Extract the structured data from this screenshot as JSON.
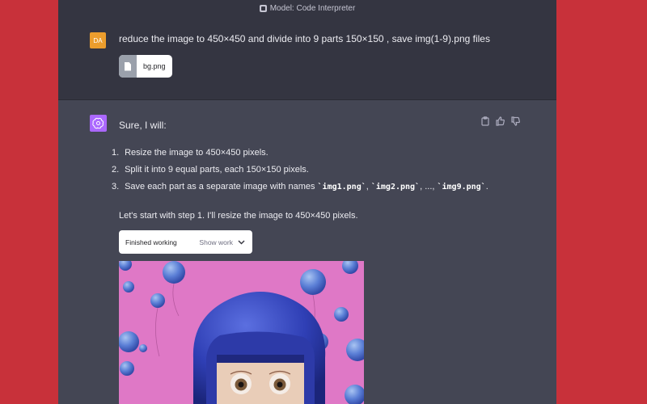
{
  "model_bar": {
    "label": "Model: Code Interpreter",
    "icon": "code-interpreter-icon"
  },
  "user": {
    "avatar_initials": "DA",
    "message": "reduce the image to 450×450 and divide into 9 parts 150×150 , save img(1-9).png files",
    "attachment": {
      "filename": "bg.png",
      "icon": "file-icon"
    }
  },
  "assistant": {
    "intro": "Sure, I will:",
    "steps": [
      {
        "num": "1.",
        "text": "Resize the image to 450×450 pixels."
      },
      {
        "num": "2.",
        "text": "Split it into 9 equal parts, each 150×150 pixels."
      },
      {
        "num": "3.",
        "pre": "Save each part as a separate image with names ",
        "code1": "`img1.png`",
        "sep1": ", ",
        "code2": "`img2.png`",
        "sep2": ", ..., ",
        "code3": "`img9.png`",
        "post": "."
      }
    ],
    "start_text": "Let's start with step 1. I'll resize the image to 450×450 pixels.",
    "working": {
      "label": "Finished working",
      "show_label": "Show work"
    },
    "actions": [
      "copy-icon",
      "thumbs-up-icon",
      "thumbs-down-icon"
    ]
  },
  "colors": {
    "background": "#c8313a",
    "user_bg": "#343541",
    "assistant_bg": "#444654",
    "user_avatar": "#eb9d2d",
    "assistant_avatar": "#ab68ff",
    "image_pink": "#df78c6",
    "hair_blue": "#2f3fb5"
  }
}
